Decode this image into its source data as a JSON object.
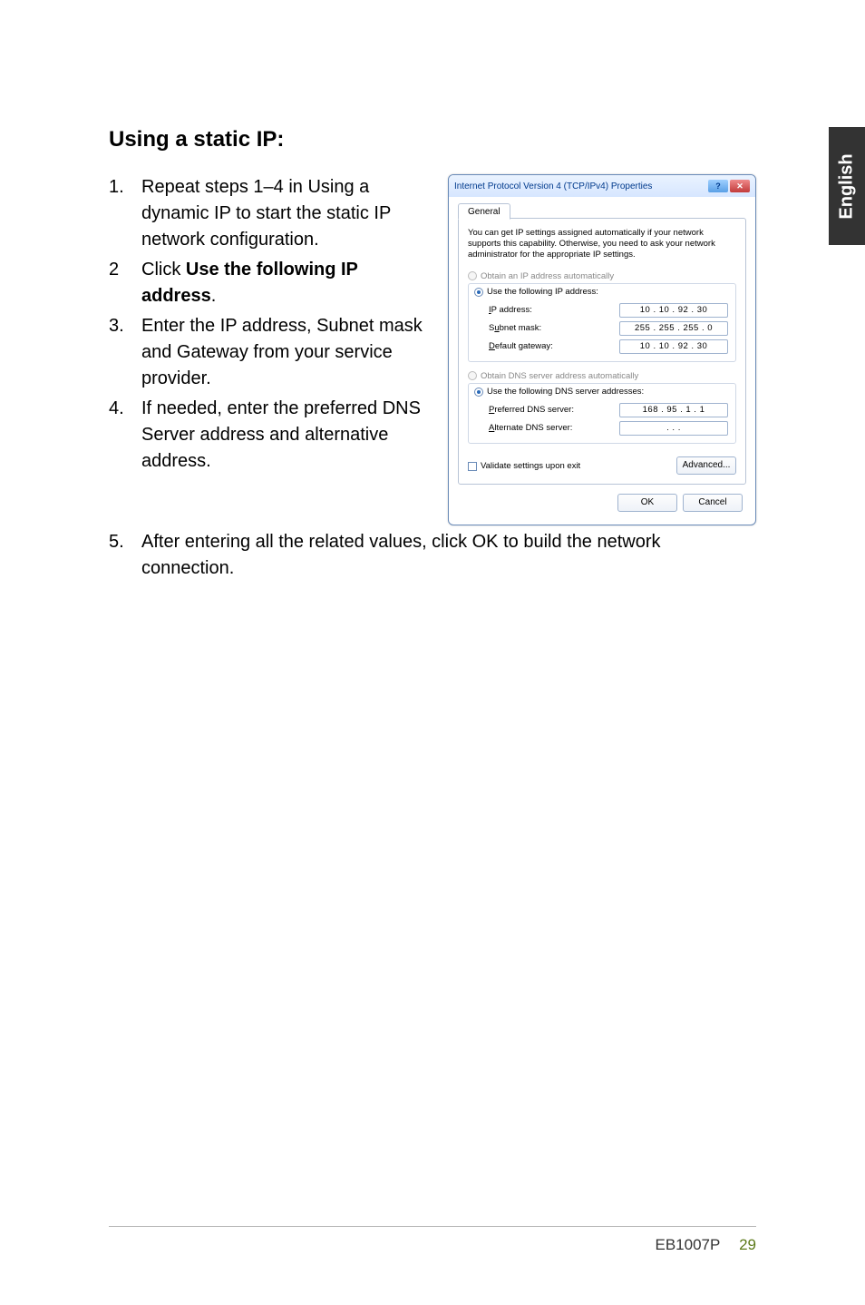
{
  "side_tab": "English",
  "heading": "Using a static IP:",
  "steps": [
    {
      "num": "1.",
      "text": "Repeat steps 1–4 in Using a dynamic IP to start the static IP network configuration."
    },
    {
      "num": "2",
      "text_pre": "Click ",
      "text_bold": "Use the following IP address",
      "text_post": "."
    },
    {
      "num": "3.",
      "text": "Enter the IP address, Subnet mask and Gateway from your service provider."
    },
    {
      "num": "4.",
      "text": "If needed, enter the preferred DNS Server address and alternative address."
    }
  ],
  "step5": {
    "num": "5.",
    "text": "After entering all the related values, click OK to build the network connection."
  },
  "dialog": {
    "title": "Internet Protocol Version 4 (TCP/IPv4) Properties",
    "tab": "General",
    "description": "You can get IP settings assigned automatically if your network supports this capability. Otherwise, you need to ask your network administrator for the appropriate IP settings.",
    "radio_auto_ip": "Obtain an IP address automatically",
    "radio_use_ip": "Use the following IP address:",
    "lbl_ip": "IP address:",
    "val_ip": "10 . 10 . 92 . 30",
    "lbl_subnet": "Subnet mask:",
    "val_subnet": "255 . 255 . 255 . 0",
    "lbl_gateway": "Default gateway:",
    "val_gateway": "10 . 10 . 92 . 30",
    "radio_auto_dns": "Obtain DNS server address automatically",
    "radio_use_dns": "Use the following DNS server addresses:",
    "lbl_pref_dns": "Preferred DNS server:",
    "val_pref_dns": "168 . 95 . 1 . 1",
    "lbl_alt_dns": "Alternate DNS server:",
    "val_alt_dns": ".     .     .",
    "chk_validate": "Validate settings upon exit",
    "btn_advanced": "Advanced...",
    "btn_ok": "OK",
    "btn_cancel": "Cancel",
    "btn_help": "?",
    "btn_close": "✕"
  },
  "footer": {
    "model": "EB1007P",
    "page": "29"
  }
}
